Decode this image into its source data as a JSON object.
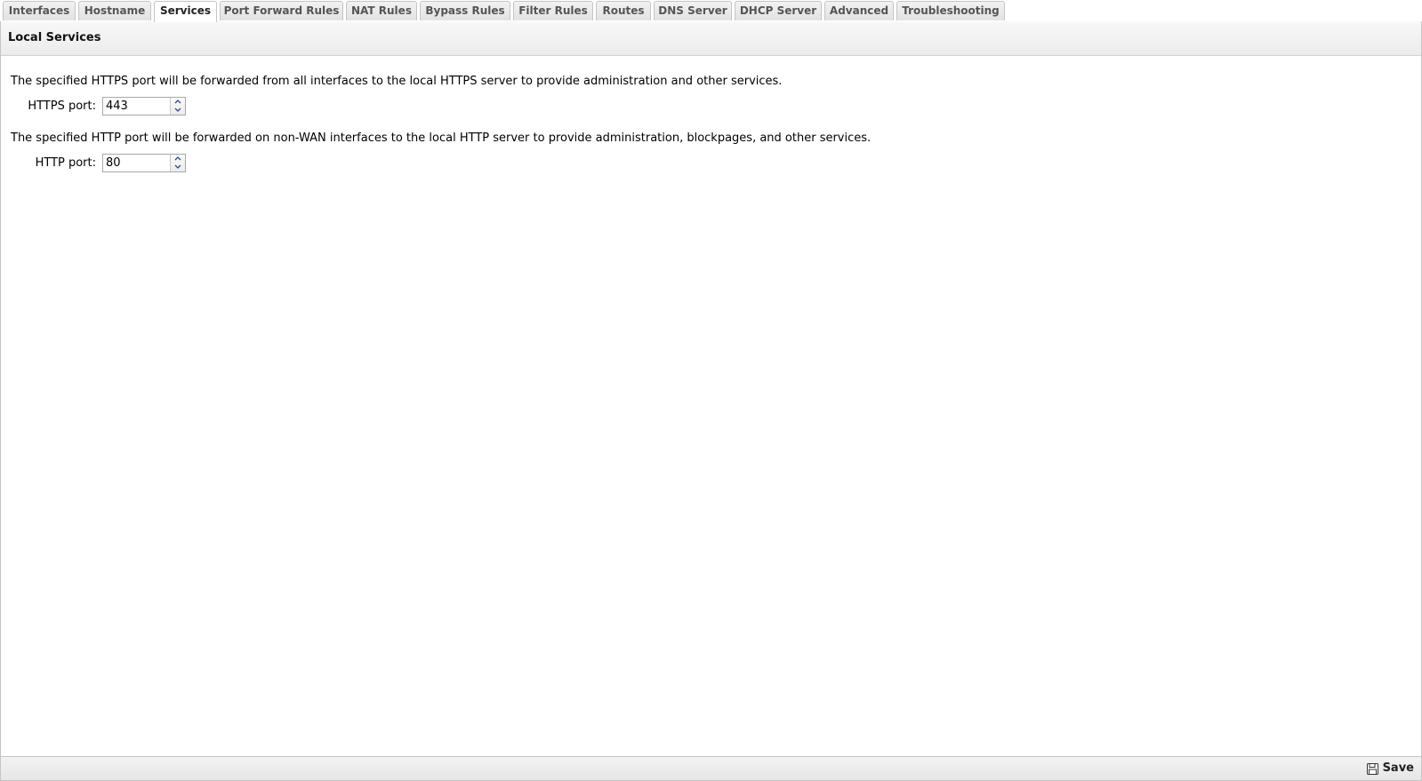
{
  "tabs": [
    {
      "label": "Interfaces"
    },
    {
      "label": "Hostname"
    },
    {
      "label": "Services",
      "active": true
    },
    {
      "label": "Port Forward Rules"
    },
    {
      "label": "NAT Rules"
    },
    {
      "label": "Bypass Rules"
    },
    {
      "label": "Filter Rules"
    },
    {
      "label": "Routes"
    },
    {
      "label": "DNS Server"
    },
    {
      "label": "DHCP Server"
    },
    {
      "label": "Advanced"
    },
    {
      "label": "Troubleshooting"
    }
  ],
  "panel": {
    "title": "Local Services",
    "https": {
      "description": "The specified HTTPS port will be forwarded from all interfaces to the local HTTPS server to provide administration and other services.",
      "label": "HTTPS port:",
      "value": "443"
    },
    "http": {
      "description": "The specified HTTP port will be forwarded on non-WAN interfaces to the local HTTP server to provide administration, blockpages, and other services.",
      "label": "HTTP port:",
      "value": "80"
    }
  },
  "footer": {
    "save_label": "Save",
    "save_icon": "floppy-disk-icon"
  }
}
